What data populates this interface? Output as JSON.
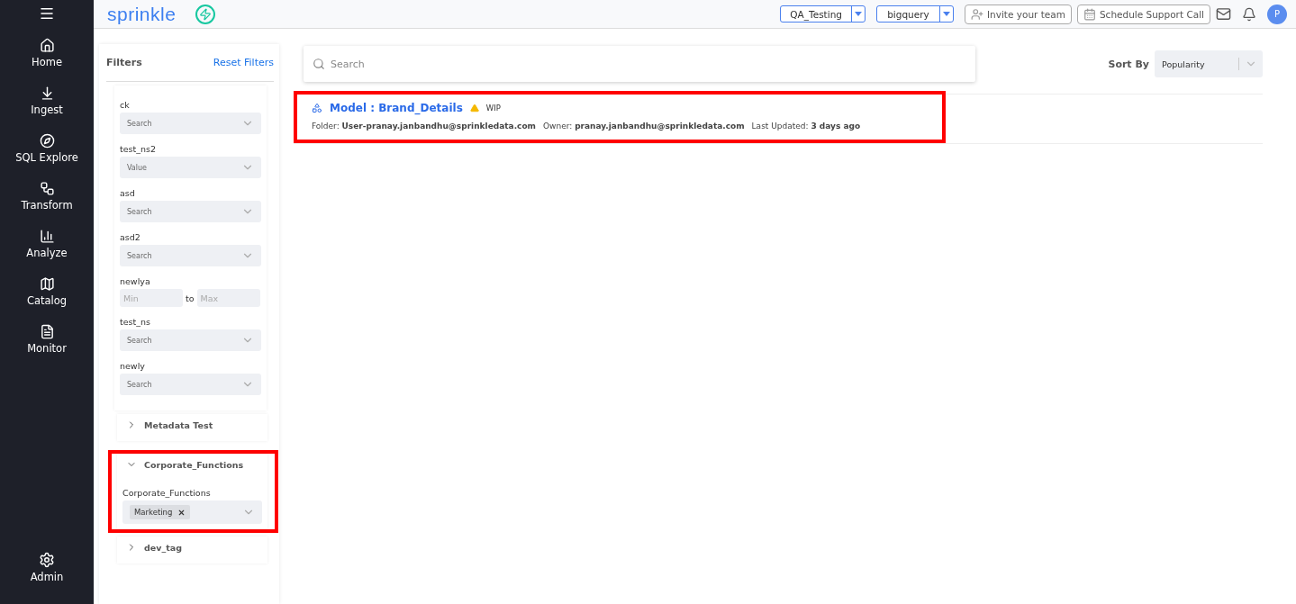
{
  "nav": {
    "items": [
      {
        "label": "Home"
      },
      {
        "label": "Ingest"
      },
      {
        "label": "SQL Explore"
      },
      {
        "label": "Transform"
      },
      {
        "label": "Analyze"
      },
      {
        "label": "Catalog"
      },
      {
        "label": "Monitor"
      }
    ],
    "admin": {
      "label": "Admin"
    }
  },
  "topbar": {
    "logo": "sprinkle",
    "workspace": "QA_Testing",
    "warehouse": "bigquery",
    "invite": "Invite your team",
    "support": "Schedule Support Call",
    "avatar": "P"
  },
  "filters": {
    "title": "Filters",
    "reset": "Reset Filters",
    "fields": [
      {
        "kind": "select",
        "label": "ck",
        "placeholder": "Search"
      },
      {
        "kind": "select",
        "label": "test_ns2",
        "placeholder": "Value"
      },
      {
        "kind": "select",
        "label": "asd",
        "placeholder": "Search"
      },
      {
        "kind": "select",
        "label": "asd2",
        "placeholder": "Search"
      },
      {
        "kind": "range",
        "label": "newlya",
        "min_placeholder": "Min",
        "separator": "to",
        "max_placeholder": "Max"
      },
      {
        "kind": "select",
        "label": "test_ns",
        "placeholder": "Search"
      },
      {
        "kind": "select",
        "label": "newly",
        "placeholder": "Search"
      }
    ],
    "groups": [
      {
        "title": "Metadata Test",
        "expanded": false,
        "highlighted": false
      },
      {
        "title": "Corporate_Functions",
        "expanded": true,
        "highlighted": true,
        "field": {
          "label": "Corporate_Functions",
          "tags": [
            "Marketing"
          ]
        }
      },
      {
        "title": "dev_tag",
        "expanded": false,
        "highlighted": false
      }
    ]
  },
  "search": {
    "placeholder": "Search"
  },
  "sort": {
    "label": "Sort By",
    "value": "Popularity"
  },
  "results": [
    {
      "title": "Model : Brand_Details",
      "badge": "WIP",
      "highlighted": true,
      "meta": [
        {
          "label": "Folder:",
          "value": "User-pranay.janbandhu@sprinkledata.com"
        },
        {
          "label": "Owner:",
          "value": "pranay.janbandhu@sprinkledata.com"
        },
        {
          "label": "Last Updated:",
          "value": "3 days ago"
        }
      ]
    }
  ]
}
